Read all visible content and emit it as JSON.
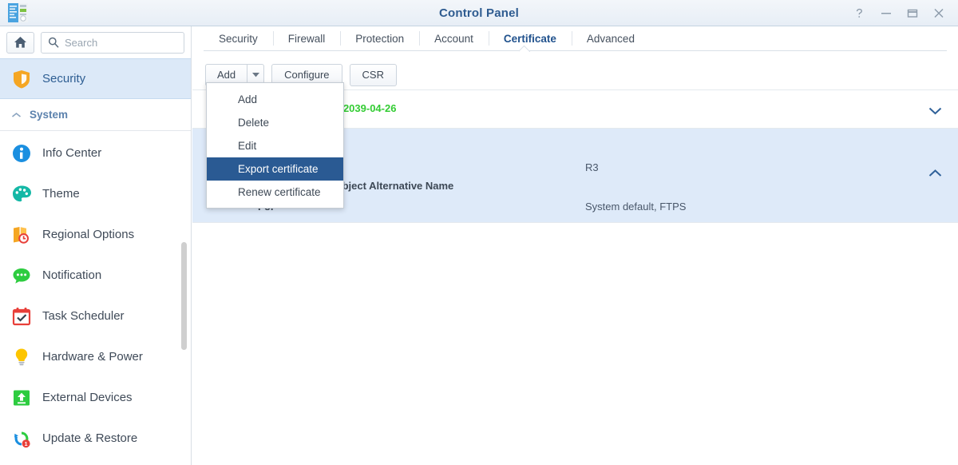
{
  "window": {
    "title": "Control Panel",
    "app_icon": "control-panel-icon",
    "controls": [
      {
        "name": "help-button",
        "glyph": "?"
      },
      {
        "name": "minimize-button",
        "glyph": "minimize"
      },
      {
        "name": "maximize-button",
        "glyph": "maximize"
      },
      {
        "name": "close-button",
        "glyph": "close"
      }
    ]
  },
  "sidebar": {
    "home_button_label": "home-icon",
    "search": {
      "value": "",
      "placeholder": "Search"
    },
    "selected_item": "Security",
    "top_items": [
      {
        "label": "Security",
        "icon": "shield-icon",
        "selected": true
      }
    ],
    "group": {
      "label": "System",
      "collapsed": false,
      "icon": "chevron-up-icon"
    },
    "items": [
      {
        "label": "Info Center",
        "icon": "info-icon"
      },
      {
        "label": "Theme",
        "icon": "palette-icon"
      },
      {
        "label": "Regional Options",
        "icon": "globe-clock-icon"
      },
      {
        "label": "Notification",
        "icon": "chat-bubble-icon"
      },
      {
        "label": "Task Scheduler",
        "icon": "calendar-check-icon"
      },
      {
        "label": "Hardware & Power",
        "icon": "lightbulb-icon"
      },
      {
        "label": "External Devices",
        "icon": "usb-upload-icon"
      },
      {
        "label": "Update & Restore",
        "icon": "refresh-icon",
        "badge": "1"
      }
    ]
  },
  "main": {
    "tabs": [
      {
        "label": "Security",
        "active": false
      },
      {
        "label": "Firewall",
        "active": false
      },
      {
        "label": "Protection",
        "active": false
      },
      {
        "label": "Account",
        "active": false
      },
      {
        "label": "Certificate",
        "active": true
      },
      {
        "label": "Advanced",
        "active": false
      }
    ],
    "toolbar": {
      "add_label": "Add",
      "add_arrow": "chevron-down-icon",
      "configure_label": "Configure",
      "csr_label": "CSR"
    },
    "dropdown_menu": {
      "open": true,
      "items": [
        {
          "label": "Add",
          "highlighted": false
        },
        {
          "label": "Delete",
          "highlighted": false
        },
        {
          "label": "Edit",
          "highlighted": false
        },
        {
          "label": "Export certificate",
          "highlighted": true
        },
        {
          "label": "Renew certificate",
          "highlighted": false
        }
      ]
    },
    "certificates": [
      {
        "expanded": false,
        "selected": false,
        "expiry_text": "- 2039-04-26",
        "chevron": "chevron-down-icon"
      },
      {
        "expanded": true,
        "selected": true,
        "chevron": "chevron-up-icon",
        "fields": [
          {
            "label": "",
            "value": "R3"
          },
          {
            "label": "Subject Alternative Name",
            "value": ""
          },
          {
            "label": "For",
            "value": "System default, FTPS"
          }
        ]
      }
    ]
  },
  "colors": {
    "title_blue": "#2e5b90",
    "accent_blue": "#21528d",
    "menu_highlight": "#2a5a93",
    "row_selected": "#deeaf9",
    "expiry_green": "#33cc33"
  }
}
